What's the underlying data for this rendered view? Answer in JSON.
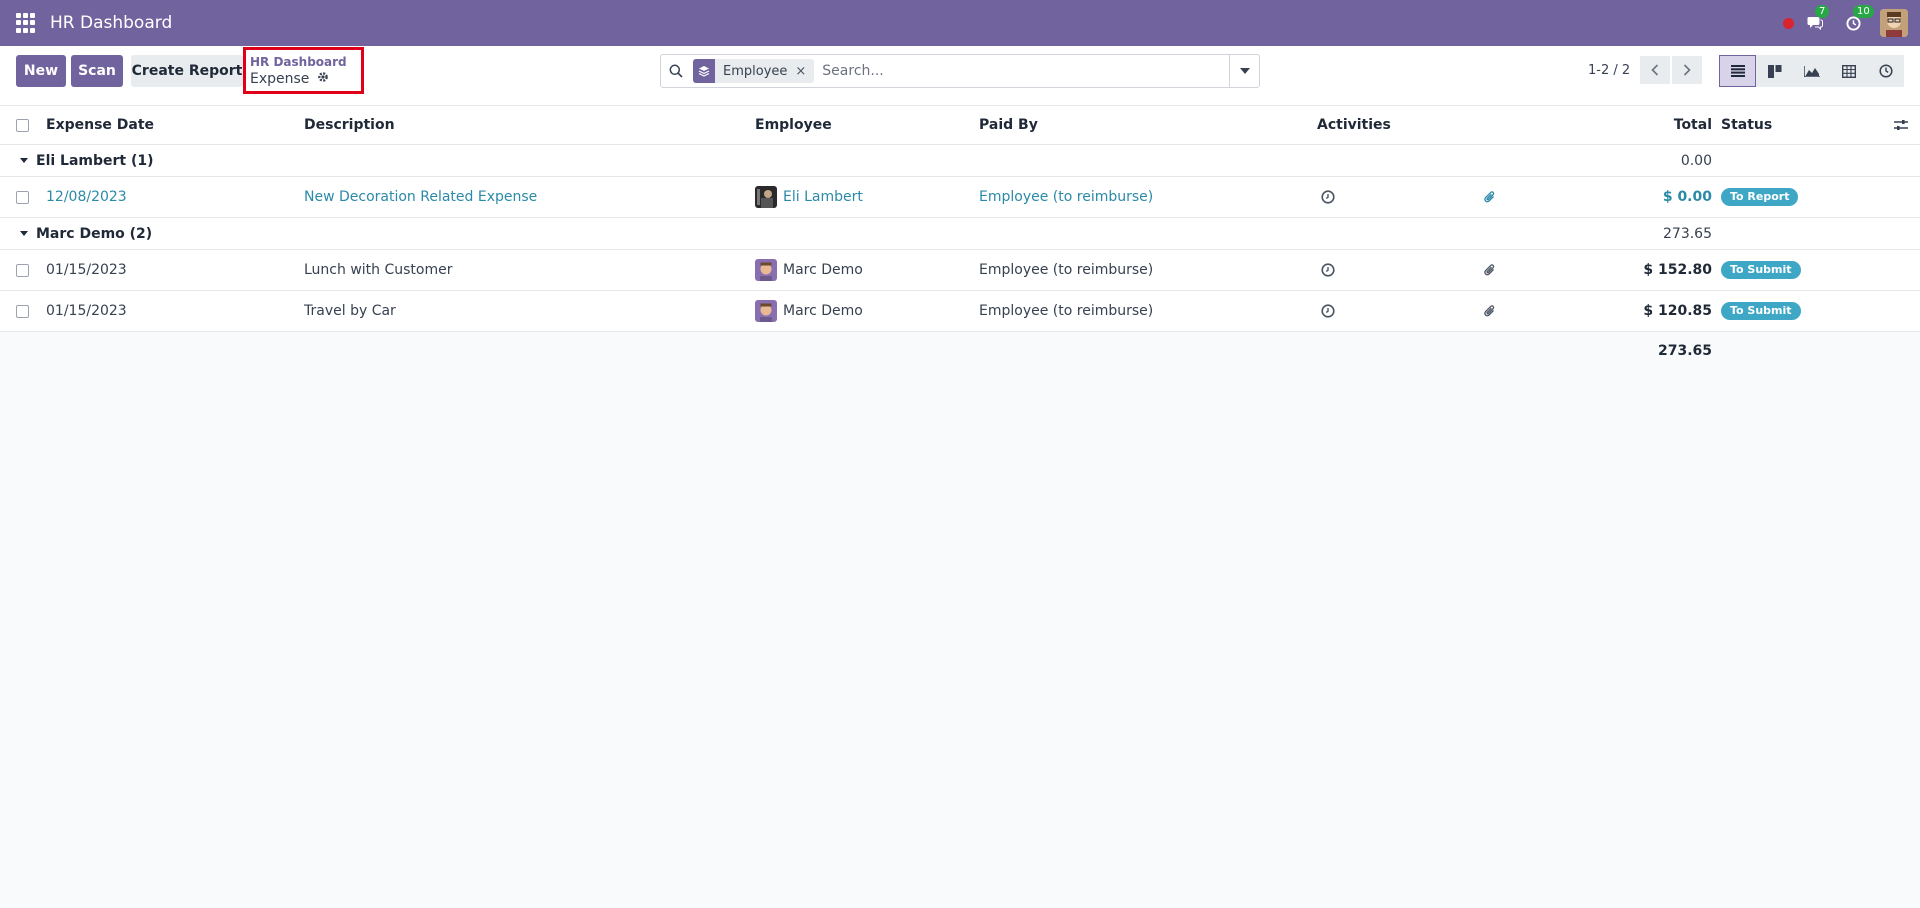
{
  "navbar": {
    "title": "HR Dashboard",
    "messages_count": "7",
    "activities_count": "10"
  },
  "control": {
    "new_label": "New",
    "scan_label": "Scan",
    "create_report_label": "Create Report",
    "breadcrumb_parent": "HR Dashboard",
    "breadcrumb_current": "Expense",
    "search": {
      "facet_label": "Employee",
      "placeholder": "Search..."
    },
    "pager": "1-2 / 2"
  },
  "table": {
    "headers": {
      "expense_date": "Expense Date",
      "description": "Description",
      "employee": "Employee",
      "paid_by": "Paid By",
      "activities": "Activities",
      "total": "Total",
      "status": "Status"
    },
    "groups": [
      {
        "label": "Eli Lambert (1)",
        "total": "0.00",
        "rows": [
          {
            "date": "12/08/2023",
            "description": "New Decoration Related Expense",
            "employee": "Eli Lambert",
            "paid_by": "Employee (to reimburse)",
            "total": "$ 0.00",
            "status": "To Report"
          }
        ]
      },
      {
        "label": "Marc Demo (2)",
        "total": "273.65",
        "rows": [
          {
            "date": "01/15/2023",
            "description": "Lunch with Customer",
            "employee": "Marc Demo",
            "paid_by": "Employee (to reimburse)",
            "total": "$ 152.80",
            "status": "To Submit"
          },
          {
            "date": "01/15/2023",
            "description": "Travel by Car",
            "employee": "Marc Demo",
            "paid_by": "Employee (to reimburse)",
            "total": "$ 120.85",
            "status": "To Submit"
          }
        ]
      }
    ],
    "grand_total": "273.65"
  },
  "colors": {
    "brand": "#71639e",
    "link": "#2b8aa7",
    "status_badge": "#3fa7c6",
    "highlight_box": "#e0001a"
  }
}
